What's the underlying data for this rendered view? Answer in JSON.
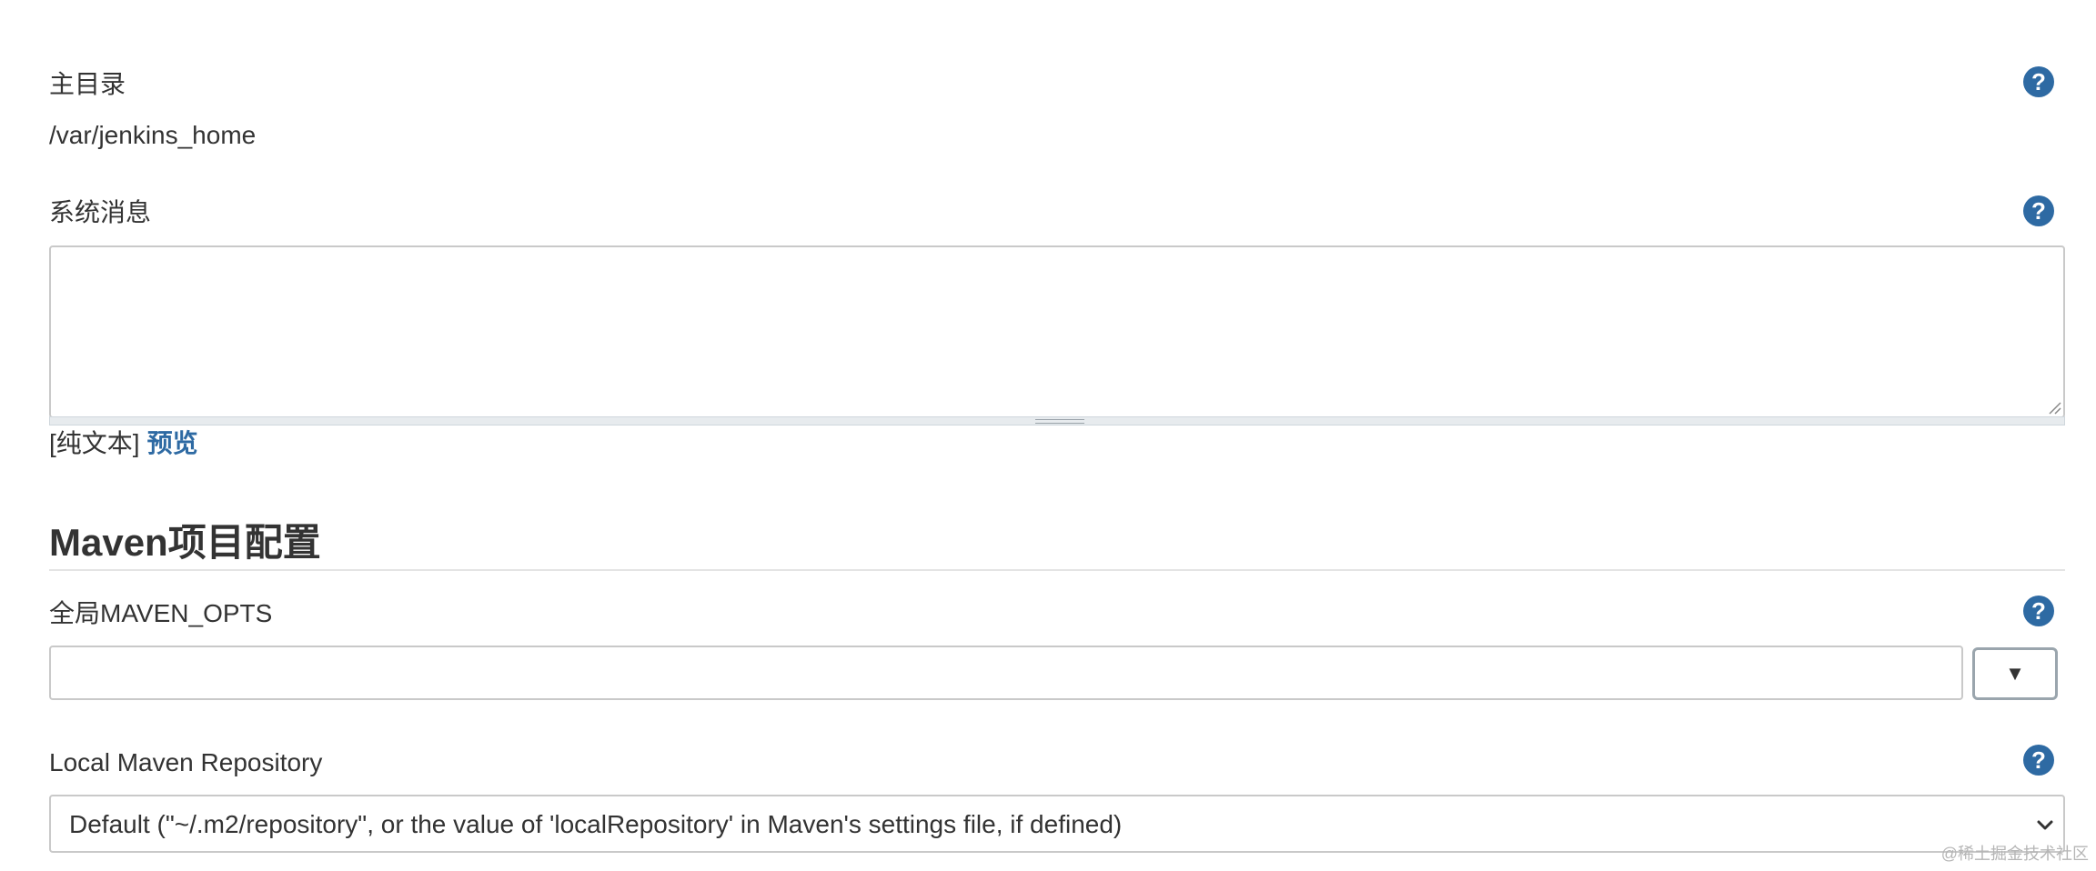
{
  "home_directory": {
    "label": "主目录",
    "value": "/var/jenkins_home",
    "help_icon": "?"
  },
  "system_message": {
    "label": "系统消息",
    "value": "",
    "help_icon": "?",
    "markup_format": "[纯文本]",
    "preview_link": "预览"
  },
  "maven_section": {
    "title": "Maven项目配置"
  },
  "global_maven_opts": {
    "label": "全局MAVEN_OPTS",
    "value": "",
    "help_icon": "?",
    "expand_button": "▼"
  },
  "local_maven_repository": {
    "label": "Local Maven Repository",
    "help_icon": "?",
    "selected_option": "Default (\"~/.m2/repository\", or the value of 'localRepository' in Maven's settings file, if defined)"
  },
  "watermark": "@稀土掘金技术社区",
  "colors": {
    "help_icon": "#2e6aa3",
    "link": "#2e6aa3",
    "text": "#333333",
    "border": "#c9c9c9"
  },
  "icons": {
    "help": "question-circle-icon",
    "dropdown": "chevron-down-icon",
    "expand": "triangle-down-icon",
    "resize": "resize-grip-icon"
  }
}
